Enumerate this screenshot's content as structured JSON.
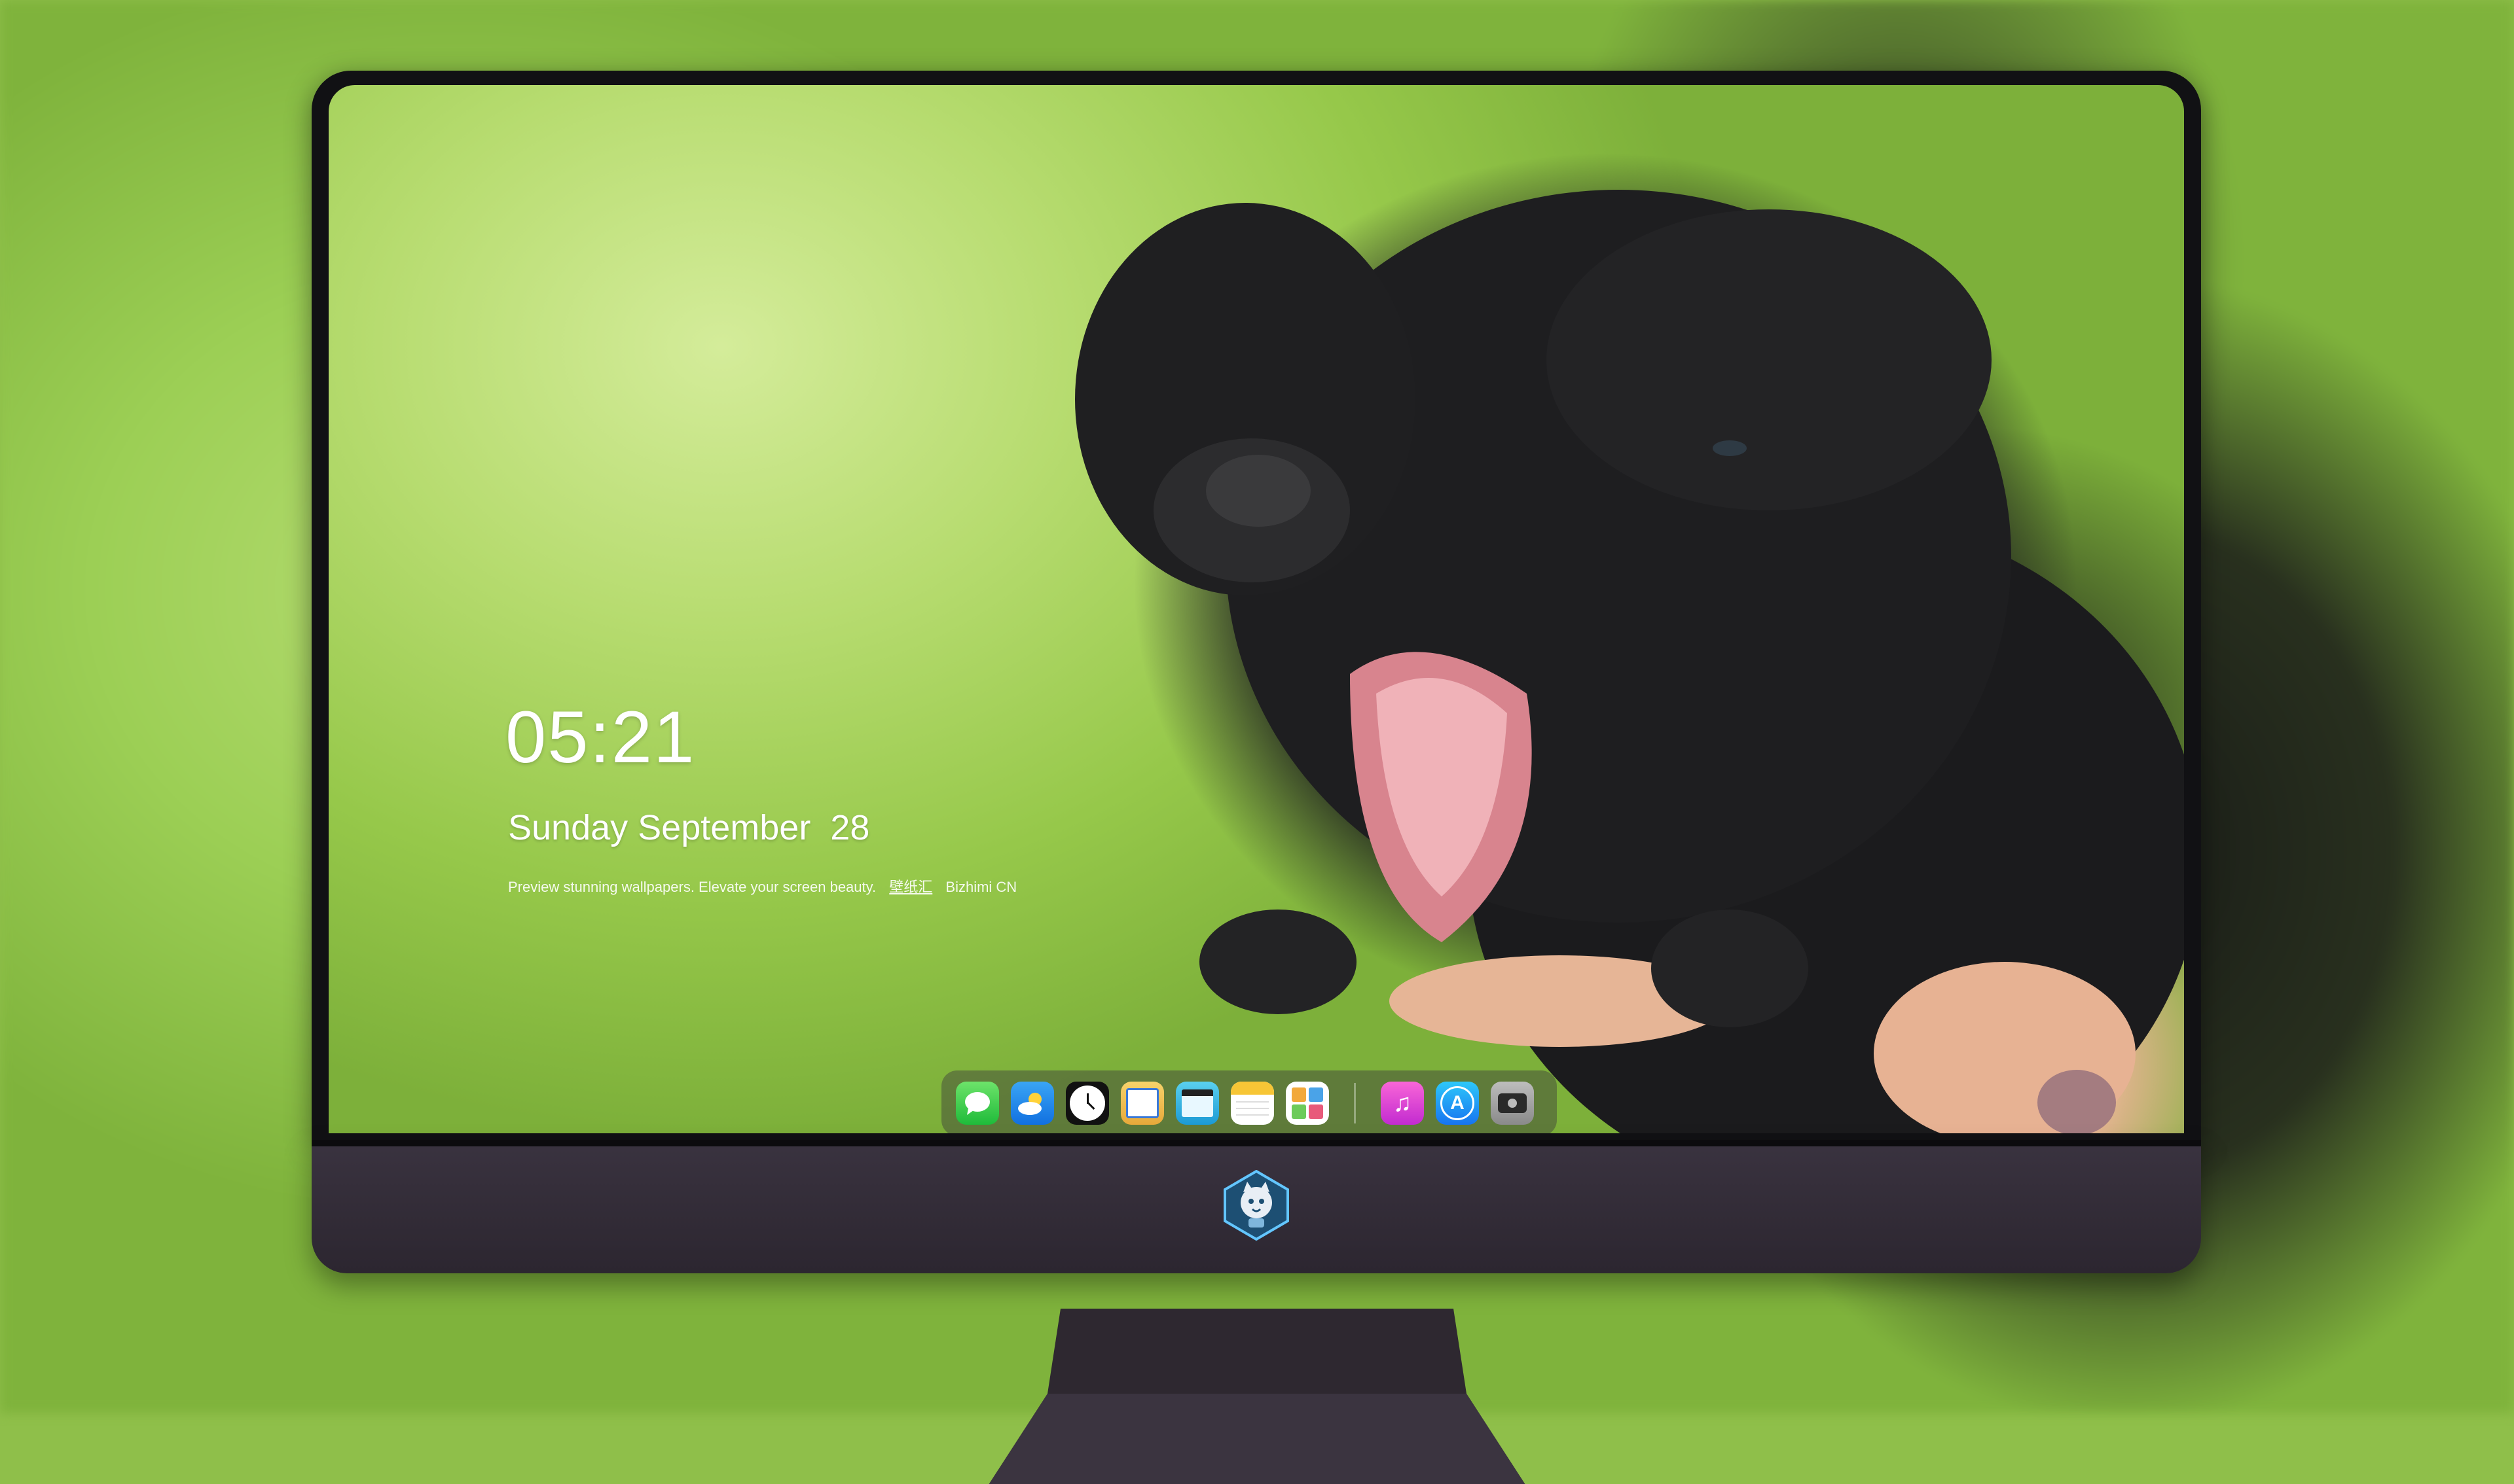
{
  "lock_screen": {
    "time": "05:21",
    "date": "Sunday September  28",
    "tagline_parts": [
      "Preview stunning wallpapers. Elevate your screen beauty.",
      "壁纸汇",
      "Bizhimi CN"
    ]
  },
  "dock": {
    "apps": [
      {
        "name": "messages-app-icon",
        "icon": "messages-icon"
      },
      {
        "name": "weather-app-icon",
        "icon": "weather-icon"
      },
      {
        "name": "clock-app-icon",
        "icon": "clock-icon"
      },
      {
        "name": "preview-app-icon",
        "icon": "preview-icon"
      },
      {
        "name": "clips-app-icon",
        "icon": "clapperboard-icon"
      },
      {
        "name": "notes-app-icon",
        "icon": "notes-icon"
      },
      {
        "name": "photo-booth-app-icon",
        "icon": "photos-icon"
      },
      {
        "name": "music-app-icon",
        "icon": "music-note-icon"
      },
      {
        "name": "app-store-app-icon",
        "icon": "app-store-icon"
      },
      {
        "name": "screenshot-app-icon",
        "icon": "camera-icon"
      }
    ]
  },
  "monitor": {
    "logo": "cat-mascot-logo"
  },
  "colors": {
    "wallpaper_green": "#9ccd52",
    "bezel": "#111114",
    "chin": "#332c38"
  }
}
